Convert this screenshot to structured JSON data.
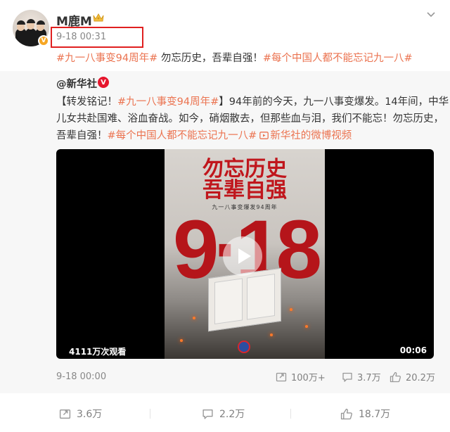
{
  "post": {
    "username": "M鹿M",
    "timestamp": "9-18 00:31",
    "content": {
      "tag1": "#九一八事变94周年#",
      "text": " 勿忘历史，吾辈自强！",
      "tag2": "#每个中国人都不能忘记九一八#"
    }
  },
  "repost": {
    "author": "@新华社",
    "line1": {
      "prefix": "【转发铭记！",
      "tag": "#九一八事变94周年#",
      "suffix": "】94年前的今天，九一八事变爆发。14年间，中华"
    },
    "line2": "儿女共赴国难、浴血奋战。如今，硝烟散去，但那些血与泪，我们不能忘！勿忘历史，",
    "line3": {
      "prefix": "吾辈自强！",
      "tag": "#每个中国人都不能忘记九一八#",
      "link": "新华社的微博视频"
    },
    "video": {
      "poster_title_1": "勿忘历史",
      "poster_title_2": "吾辈自强",
      "poster_subtitle": "九一八事变爆发94周年",
      "poster_big": "9·18",
      "views": "4111万次观看",
      "duration": "00:06"
    },
    "time": "9-18 00:00",
    "stats": {
      "reposts": "100万+",
      "comments": "3.7万",
      "likes": "20.2万"
    }
  },
  "actions": {
    "repost": "3.6万",
    "comment": "2.2万",
    "like": "18.7万"
  },
  "colors": {
    "tag": "#eb7350",
    "highlight_box": "#e02020",
    "repost_bg": "#f7f7f7",
    "muted": "#808080"
  },
  "icons": [
    "verified-badge-icon",
    "crown-icon",
    "chevron-down-icon",
    "play-icon",
    "video-link-icon",
    "repost-icon",
    "comment-icon",
    "like-icon"
  ]
}
